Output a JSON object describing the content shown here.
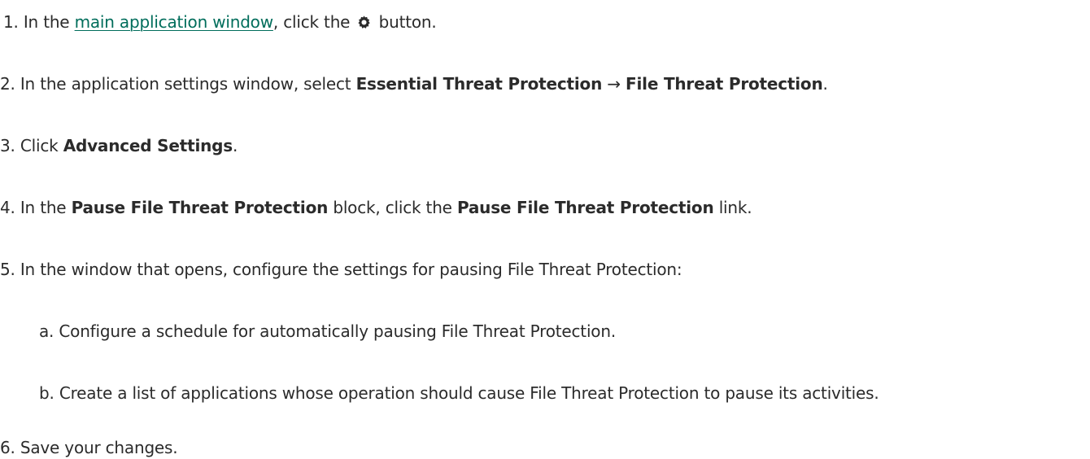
{
  "steps": [
    {
      "number": "1.",
      "prefix": "In the",
      "link_text": "main application window",
      "mid": ", click the",
      "icon": "gear-icon",
      "suffix": "button."
    },
    {
      "number": "2.",
      "prefix": "In the application settings window, select",
      "bold1": "Essential Threat Protection",
      "arrow": "→",
      "bold2": "File Threat Protection",
      "suffix": "."
    },
    {
      "number": "3.",
      "prefix": "Click",
      "bold1": "Advanced Settings",
      "suffix": "."
    },
    {
      "number": "4.",
      "prefix": "In the",
      "bold1": "Pause File Threat Protection",
      "mid": "block, click the",
      "bold2": "Pause File Threat Protection",
      "suffix": "link."
    },
    {
      "number": "5.",
      "text": "In the window that opens, configure the settings for pausing File Threat Protection:"
    },
    {
      "number": "a.",
      "text": "Configure a schedule for automatically pausing File Threat Protection."
    },
    {
      "number": "b.",
      "text": "Create a list of applications whose operation should cause File Threat Protection to pause its activities."
    },
    {
      "number": "6.",
      "text": "Save your changes."
    }
  ],
  "colors": {
    "text": "#2b2b2b",
    "link": "#006d5b"
  }
}
